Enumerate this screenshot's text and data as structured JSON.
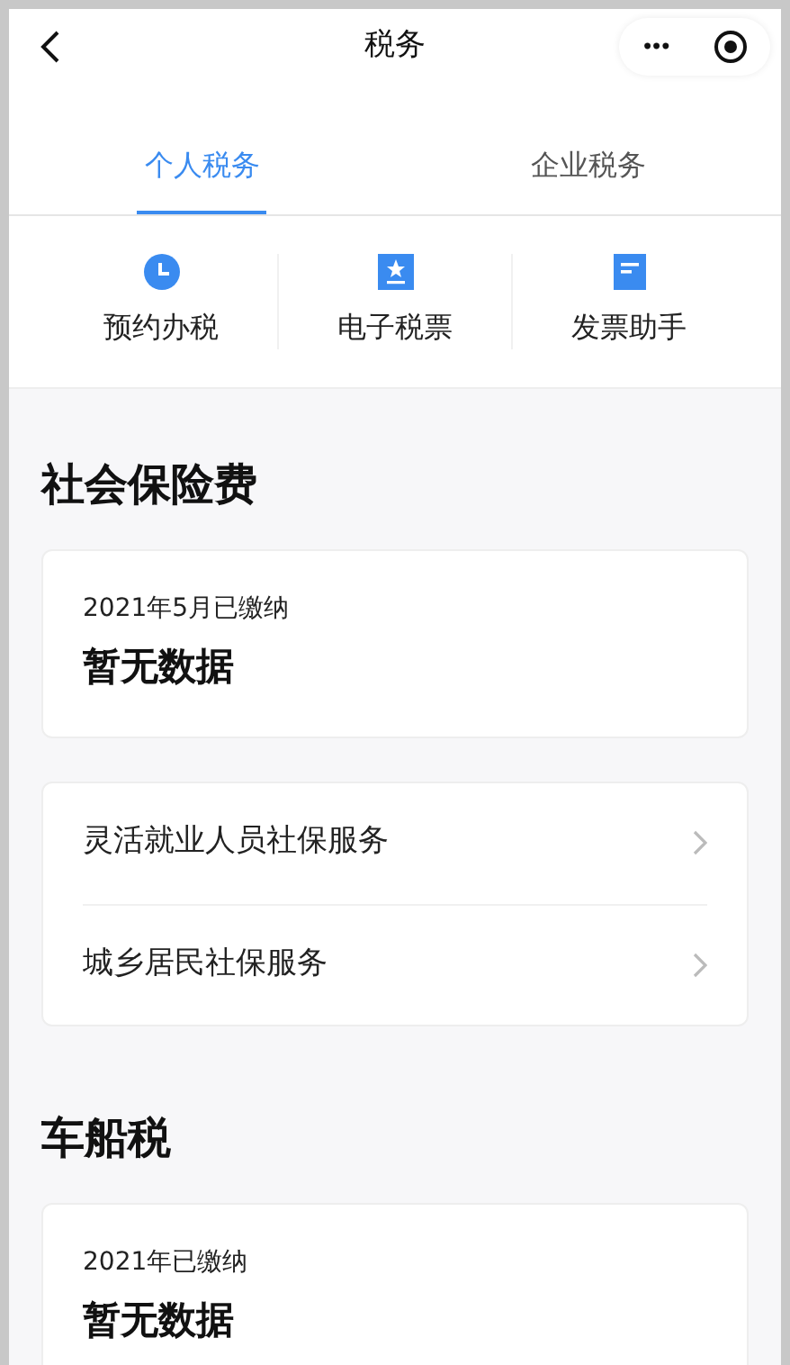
{
  "nav": {
    "title": "税务",
    "more": "•••"
  },
  "tabs": [
    {
      "label": "个人税务",
      "selected": true
    },
    {
      "label": "企业税务",
      "selected": false
    }
  ],
  "shortcuts": [
    {
      "label": "预约办税",
      "kind": "clock"
    },
    {
      "label": "电子税票",
      "kind": "ticket"
    },
    {
      "label": "发票助手",
      "kind": "doc"
    }
  ],
  "sections": [
    {
      "title": "社会保险费",
      "summary": {
        "period": "2021年5月已缴纳",
        "value": "暂无数据"
      },
      "links": [
        "灵活就业人员社保服务",
        "城乡居民社保服务"
      ]
    },
    {
      "title": "车船税",
      "summary": {
        "period": "2021年已缴纳",
        "value": "暂无数据"
      }
    }
  ]
}
